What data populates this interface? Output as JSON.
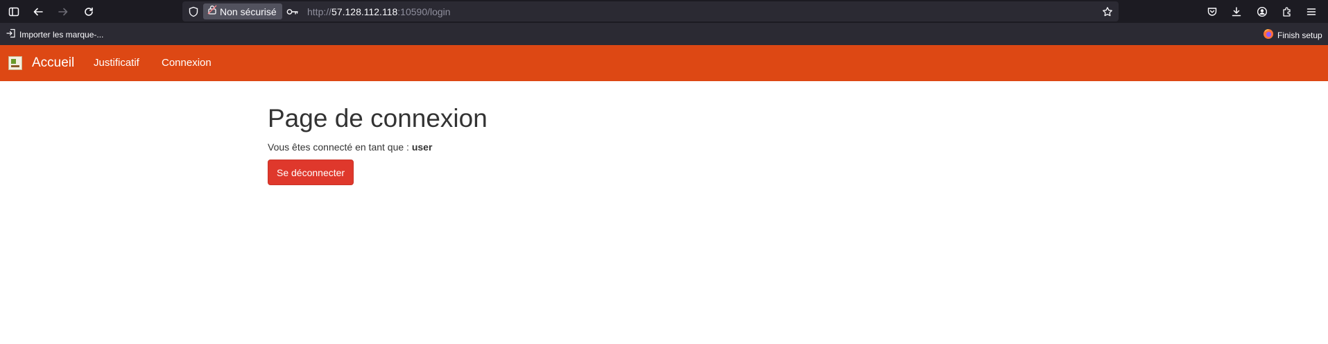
{
  "browser": {
    "tracking_protection_icon": "shield-icon",
    "permission_label": "Non sécurisé",
    "url_scheme": "http://",
    "url_host": "57.128.112.118",
    "url_rest": ":10590/login",
    "bookmarks": {
      "import_label": "Importer les marque-...",
      "finish_setup_label": "Finish setup"
    }
  },
  "navbar": {
    "brand": "Accueil",
    "links": [
      "Justificatif",
      "Connexion"
    ],
    "color": "#dd4814"
  },
  "main": {
    "title": "Page de connexion",
    "status_prefix": "Vous êtes connecté en tant que :",
    "username": "user",
    "logout_label": "Se déconnecter",
    "logout_color": "#df382c"
  }
}
